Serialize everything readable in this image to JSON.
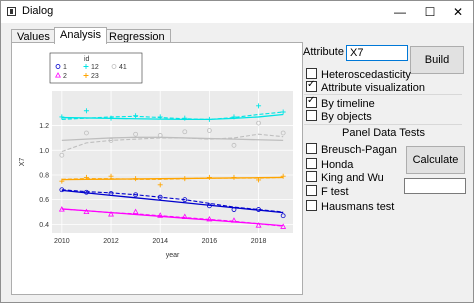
{
  "window": {
    "title": "Dialog",
    "minimize": "—",
    "maximize": "☐",
    "close": "✕"
  },
  "tabs": [
    {
      "label": "Values",
      "active": false
    },
    {
      "label": "Analysis",
      "active": true
    },
    {
      "label": "Regression",
      "active": false
    }
  ],
  "attribute": {
    "label": "Attribute",
    "value": "X7"
  },
  "build_button": "Build",
  "options": [
    {
      "label": "Heteroscedasticity",
      "checked": false
    },
    {
      "label": "Attribute visualization",
      "checked": true
    },
    {
      "label": "By timeline",
      "checked": true
    },
    {
      "label": "By objects",
      "checked": false
    }
  ],
  "panel_tests": {
    "heading": "Panel Data Tests",
    "tests": [
      {
        "label": "Breusch-Pagan",
        "checked": false
      },
      {
        "label": "Honda",
        "checked": false
      },
      {
        "label": "King and Wu",
        "checked": false
      },
      {
        "label": "F test",
        "checked": false
      },
      {
        "label": "Hausmans test",
        "checked": false
      }
    ],
    "calculate_button": "Calculate",
    "result_value": ""
  },
  "chart_data": {
    "type": "scatter",
    "xlabel": "year",
    "ylabel": "X7",
    "xlim": [
      2009.6,
      2019.4
    ],
    "ylim": [
      0.33,
      1.48
    ],
    "x_ticks": [
      "2010",
      "2012",
      "2014",
      "2016",
      "2018"
    ],
    "y_ticks": [
      "0.4",
      "0.6",
      "0.8",
      "1.0",
      "1.2"
    ],
    "grid": true,
    "legend": {
      "title": "id",
      "placement": "top-left",
      "entries": [
        {
          "name": "1",
          "color": "#0000cd",
          "marker": "circle"
        },
        {
          "name": "12",
          "color": "#00e5e5",
          "marker": "plus"
        },
        {
          "name": "41",
          "color": "#bebebe",
          "marker": "circle"
        },
        {
          "name": "2",
          "color": "#ff00ff",
          "marker": "triangle"
        },
        {
          "name": "23",
          "color": "#ffa500",
          "marker": "plus"
        }
      ]
    },
    "series": [
      {
        "name": "12",
        "color": "#00e5e5",
        "x": [
          2010,
          2011,
          2012,
          2013,
          2014,
          2015,
          2016,
          2017,
          2018,
          2019
        ],
        "points": [
          1.27,
          1.32,
          1.26,
          1.28,
          1.27,
          1.26,
          1.25,
          1.27,
          1.36,
          1.31
        ],
        "smooth": [
          1.25,
          1.26,
          1.27,
          1.275,
          1.265,
          1.255,
          1.25,
          1.265,
          1.29,
          1.31
        ],
        "fit": [
          1.265,
          1.262,
          1.258,
          1.255,
          1.252,
          1.25,
          1.25,
          1.258,
          1.27,
          1.29
        ]
      },
      {
        "name": "41",
        "color": "#bebebe",
        "x": [
          2010,
          2011,
          2012,
          2013,
          2014,
          2015,
          2016,
          2017,
          2018,
          2019
        ],
        "points": [
          0.96,
          1.14,
          1.08,
          1.13,
          1.12,
          1.15,
          1.16,
          1.04,
          1.22,
          1.14
        ],
        "smooth": [
          0.99,
          1.06,
          1.08,
          1.09,
          1.1,
          1.1,
          1.09,
          1.1,
          1.13,
          1.11
        ],
        "fit": [
          1.08,
          1.09,
          1.1,
          1.105,
          1.105,
          1.1,
          1.095,
          1.09,
          1.085,
          1.08
        ]
      },
      {
        "name": "23",
        "color": "#ffa500",
        "x": [
          2010,
          2011,
          2012,
          2013,
          2014,
          2015,
          2016,
          2017,
          2018,
          2019
        ],
        "points": [
          0.75,
          0.78,
          0.79,
          0.77,
          0.72,
          0.77,
          0.78,
          0.78,
          0.76,
          0.79
        ],
        "smooth": [
          0.765,
          0.77,
          0.77,
          0.765,
          0.765,
          0.77,
          0.775,
          0.775,
          0.775,
          0.78
        ],
        "fit": [
          0.762,
          0.764,
          0.766,
          0.768,
          0.77,
          0.772,
          0.774,
          0.776,
          0.778,
          0.78
        ]
      },
      {
        "name": "1",
        "color": "#0000cd",
        "x": [
          2010,
          2011,
          2012,
          2013,
          2014,
          2015,
          2016,
          2017,
          2018,
          2019
        ],
        "points": [
          0.68,
          0.66,
          0.65,
          0.64,
          0.62,
          0.6,
          0.55,
          0.52,
          0.52,
          0.47
        ],
        "smooth": [
          0.68,
          0.665,
          0.655,
          0.64,
          0.62,
          0.6,
          0.57,
          0.54,
          0.52,
          0.5
        ],
        "fit": [
          0.675,
          0.655,
          0.635,
          0.615,
          0.595,
          0.575,
          0.555,
          0.535,
          0.515,
          0.495
        ]
      },
      {
        "name": "2",
        "color": "#ff00ff",
        "x": [
          2010,
          2011,
          2012,
          2013,
          2014,
          2015,
          2016,
          2017,
          2018,
          2019
        ],
        "points": [
          0.52,
          0.5,
          0.48,
          0.5,
          0.47,
          0.46,
          0.44,
          0.43,
          0.39,
          0.38
        ],
        "smooth": [
          0.525,
          0.51,
          0.495,
          0.485,
          0.47,
          0.455,
          0.44,
          0.425,
          0.405,
          0.385
        ],
        "fit": [
          0.525,
          0.51,
          0.495,
          0.48,
          0.465,
          0.45,
          0.435,
          0.42,
          0.405,
          0.39
        ]
      }
    ]
  }
}
